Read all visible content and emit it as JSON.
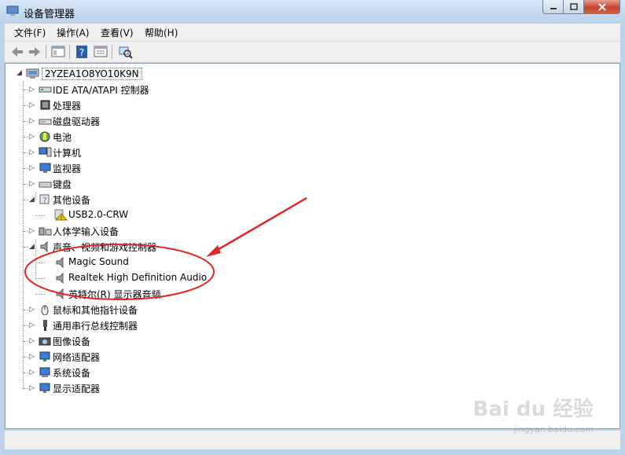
{
  "window": {
    "title": "设备管理器"
  },
  "menu": {
    "file": "文件(F)",
    "action": "操作(A)",
    "view": "查看(V)",
    "help": "帮助(H)"
  },
  "tree": {
    "root": "2YZEA1O8YO10K9N",
    "items": [
      "IDE ATA/ATAPI 控制器",
      "处理器",
      "磁盘驱动器",
      "电池",
      "计算机",
      "监视器",
      "键盘",
      "其他设备",
      "USB2.0-CRW",
      "人体学输入设备",
      "声音、视频和游戏控制器",
      "Magic Sound",
      "Realtek High Definition Audio",
      "英特尔(R) 显示器音频",
      "鼠标和其他指针设备",
      "通用串行总线控制器",
      "图像设备",
      "网络适配器",
      "系统设备",
      "显示适配器"
    ]
  },
  "watermark": {
    "brand": "Bai du 经验",
    "url": "jingyan.baidu.com"
  },
  "annotation": {
    "color": "#e0282a"
  }
}
